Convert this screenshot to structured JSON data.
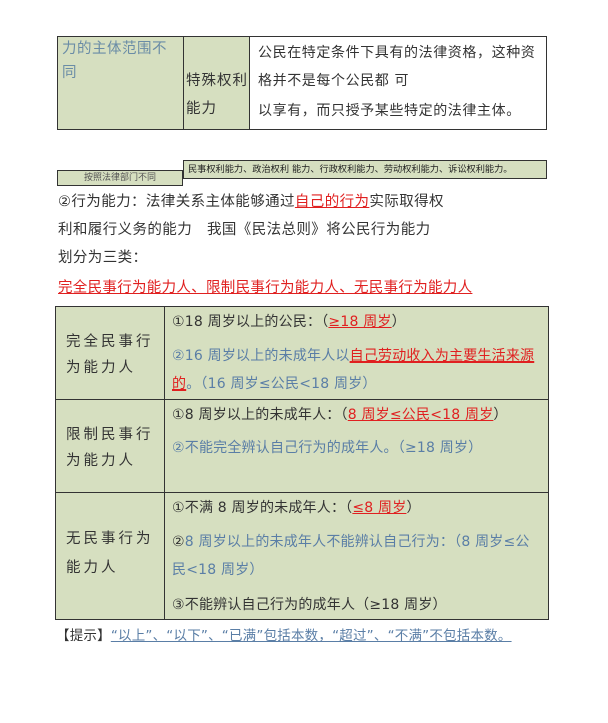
{
  "top_table": {
    "col1_lines": [
      "力的主体范围不",
      "同"
    ],
    "col2_lines": [
      "特殊权利",
      "能力"
    ],
    "col3_lines": [
      "公民在特定条件下具有的法律资格，这种资",
      "格并不是每个公民都 可",
      "以享有，而只授予某些特定的法律主体。"
    ]
  },
  "tags": {
    "left": "按照法律部门不同",
    "right": "民事权利能力、政治权利 能力、行政权利能力、劳动权利能力、诉讼权利能力。"
  },
  "paragraph": {
    "l1_a": "②行为能力：法律关系主体能够通过",
    "l1_b": "自己的行为",
    "l1_c": "实际取得权",
    "l2": "利和履行义务的能力　我国《民法总则》将公民行为能力",
    "l3": "划分为三类：",
    "l4": "完全民事行为能力人、限制民事行为能力人、无民事行为能力人"
  },
  "main_table": {
    "full": {
      "label": [
        "完全民事行",
        "为能力人"
      ],
      "r1_a": "①18 周岁以上的公民：（",
      "r1_b": "≥18 周岁",
      "r1_c": "）",
      "r2_a": "②16 周岁以上的未成年人以",
      "r2_b": "自己劳动收入为主要生活来源",
      "r3_a": "的",
      "r3_b": "。（16 周岁≤公民<18 周岁）"
    },
    "limited": {
      "label": [
        "限制民事行",
        "为能力人"
      ],
      "r1_a": "①8 周岁以上的未成年人：（",
      "r1_b": "8 周岁≤公民<18 周岁",
      "r1_c": "）",
      "r2": "②不能完全辨认自己行为的成年人。（≥18 周岁）"
    },
    "none": {
      "label": [
        "无民事行为",
        "能力人"
      ],
      "r1_a": "①不满 8 周岁的未成年人：（",
      "r1_b": "≤8 周岁",
      "r1_c": "）",
      "r2_a": "②",
      "r2_b": "8 周岁以上的未成年人不能辨认自己行为：（8 周岁≤公",
      "r3": "民<18 周岁）",
      "r4": "③不能辨认自己行为的成年人（≥18 周岁）"
    }
  },
  "tip": {
    "bracket": "【提示】",
    "text": "“以上”、“以下”、“已满”包括本数，“超过”、“不满”不包括本数。"
  },
  "colors": {
    "table_bg": "#d6dfc0",
    "red": "#e02020",
    "blue": "#5a7ea6"
  }
}
